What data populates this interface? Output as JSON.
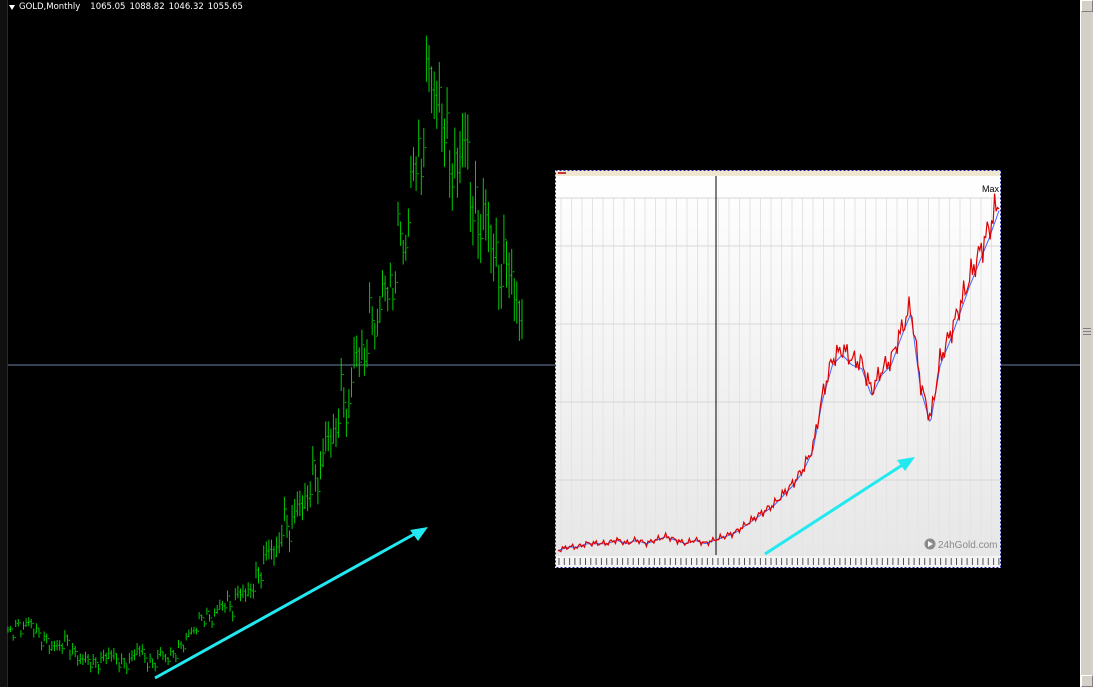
{
  "header": {
    "symbol": "GOLD,Monthly",
    "open": "1065.05",
    "high": "1088.82",
    "low": "1046.32",
    "close": "1055.65",
    "dropdown_icon": "triangle-down-icon"
  },
  "colors": {
    "background": "#000000",
    "candles": "#00cc00",
    "trend_arrow": "#22e8f0",
    "crosshair": "#6b7f9f",
    "inset_line": "#dd0000",
    "inset_average": "#4466ff"
  },
  "inset": {
    "corner_label": "Max",
    "watermark": "24hGold.com",
    "watermark_icon": "play-circle-icon",
    "x_tick_label_pattern": "2-digit year labels, too small to read"
  },
  "chart_data": [
    {
      "type": "bar",
      "title": "GOLD,Monthly",
      "description_values_relative": true,
      "series": [
        {
          "name": "GOLD,Monthly",
          "points_monthly_approx": [
            0.06,
            0.07,
            0.07,
            0.08,
            0.06,
            0.05,
            0.04,
            0.04,
            0.05,
            0.03,
            0.02,
            0.02,
            0.01,
            0.02,
            0.03,
            0.02,
            0.01,
            0.02,
            0.04,
            0.02,
            0.01,
            0.03,
            0.02,
            0.03,
            0.04,
            0.06,
            0.07,
            0.09,
            0.08,
            0.1,
            0.11,
            0.1,
            0.13,
            0.12,
            0.14,
            0.16,
            0.2,
            0.18,
            0.24,
            0.22,
            0.27,
            0.26,
            0.31,
            0.3,
            0.38,
            0.36,
            0.44,
            0.4,
            0.52,
            0.48,
            0.56,
            0.54,
            0.62,
            0.58,
            0.7,
            0.66,
            0.82,
            0.78,
            0.96,
            0.9,
            0.88,
            0.8,
            0.78,
            0.86,
            0.74,
            0.7,
            0.72,
            0.66,
            0.62,
            0.66,
            0.58,
            0.56
          ]
        }
      ]
    },
    {
      "type": "line",
      "title": "",
      "series": [
        {
          "name": "",
          "shape_relative": [
            0.01,
            0.02,
            0.02,
            0.03,
            0.03,
            0.03,
            0.04,
            0.03,
            0.04,
            0.03,
            0.04,
            0.05,
            0.04,
            0.03,
            0.04,
            0.03,
            0.04,
            0.05,
            0.06,
            0.08,
            0.1,
            0.12,
            0.14,
            0.17,
            0.2,
            0.24,
            0.3,
            0.45,
            0.55,
            0.58,
            0.55,
            0.54,
            0.46,
            0.52,
            0.55,
            0.63,
            0.7,
            0.48,
            0.38,
            0.55,
            0.62,
            0.7,
            0.78,
            0.85,
            0.92,
            1.0
          ]
        }
      ]
    }
  ]
}
